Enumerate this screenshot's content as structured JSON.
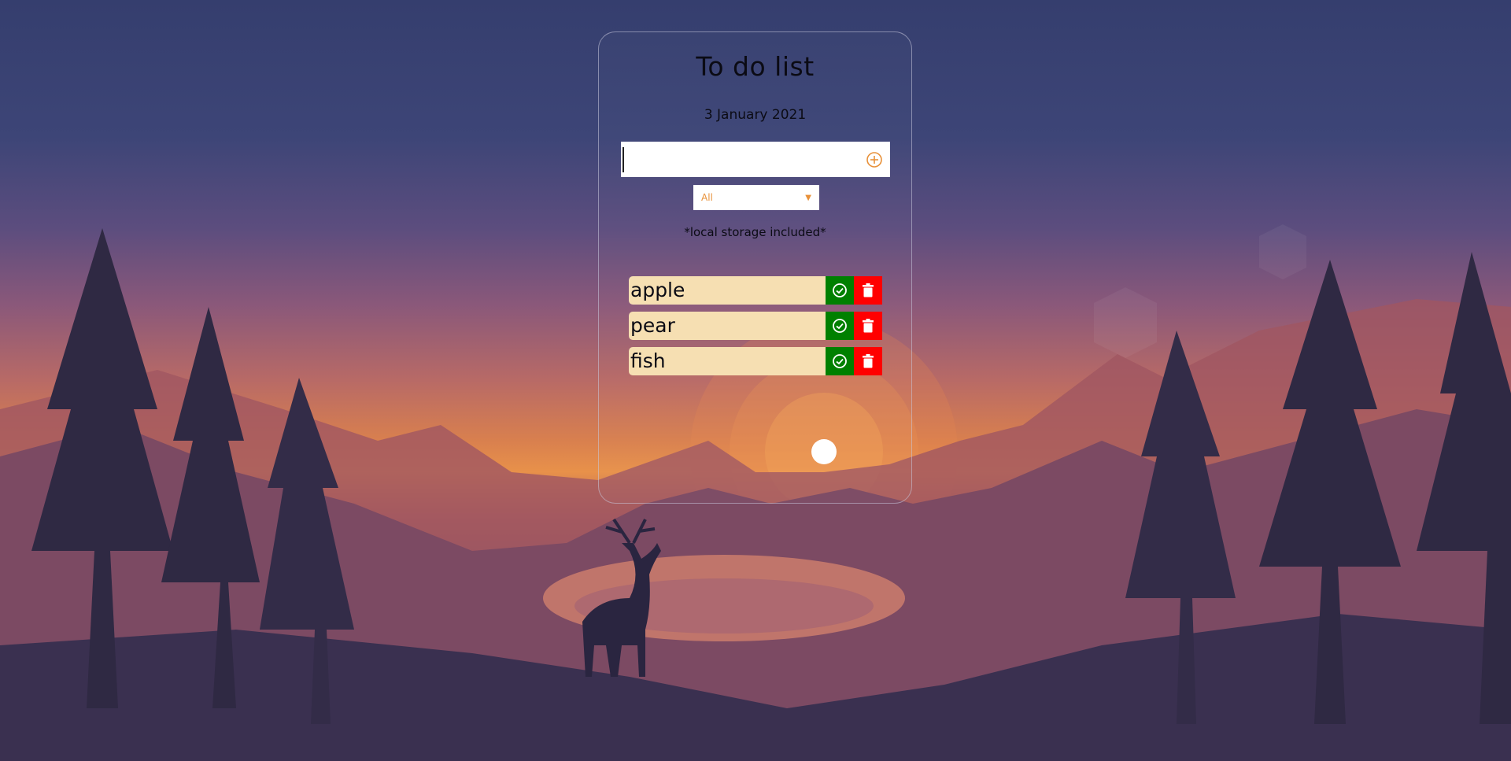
{
  "app": {
    "title": "To do list",
    "date": "3 January 2021",
    "storage_note": "*local storage included*"
  },
  "form": {
    "input_value": "",
    "add_icon": "plus-circle-icon"
  },
  "filter": {
    "selected": "All"
  },
  "todos": [
    {
      "text": "apple"
    },
    {
      "text": "pear"
    },
    {
      "text": "fish"
    }
  ],
  "colors": {
    "accent": "#e8913a",
    "item_bg": "#f6dfb2",
    "complete": "#008000",
    "trash": "#ff0000"
  }
}
